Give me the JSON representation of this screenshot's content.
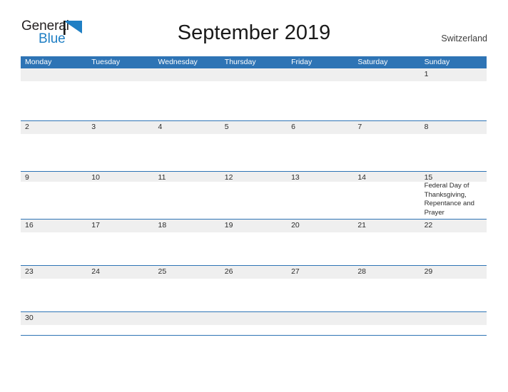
{
  "brand": {
    "line1": "General",
    "line2": "Blue",
    "flag_icon": "blue-triangle-flag-icon",
    "color_dark": "#231f20",
    "color_blue": "#1f7fc4"
  },
  "header": {
    "title": "September 2019",
    "locale": "Switzerland"
  },
  "theme": {
    "header_blue": "#2e74b5",
    "date_band_gray": "#efefef",
    "text_dark": "#2b2b2b",
    "page_background": "#ffffff"
  },
  "calendar": {
    "month": "September",
    "year": "2019",
    "first_day_of_week": "Monday",
    "weekday_headers": [
      "Monday",
      "Tuesday",
      "Wednesday",
      "Thursday",
      "Friday",
      "Saturday",
      "Sunday"
    ],
    "weeks": [
      {
        "days": [
          {
            "num": "",
            "event": ""
          },
          {
            "num": "",
            "event": ""
          },
          {
            "num": "",
            "event": ""
          },
          {
            "num": "",
            "event": ""
          },
          {
            "num": "",
            "event": ""
          },
          {
            "num": "",
            "event": ""
          },
          {
            "num": "1",
            "event": ""
          }
        ]
      },
      {
        "days": [
          {
            "num": "2",
            "event": ""
          },
          {
            "num": "3",
            "event": ""
          },
          {
            "num": "4",
            "event": ""
          },
          {
            "num": "5",
            "event": ""
          },
          {
            "num": "6",
            "event": ""
          },
          {
            "num": "7",
            "event": ""
          },
          {
            "num": "8",
            "event": ""
          }
        ]
      },
      {
        "days": [
          {
            "num": "9",
            "event": ""
          },
          {
            "num": "10",
            "event": ""
          },
          {
            "num": "11",
            "event": ""
          },
          {
            "num": "12",
            "event": ""
          },
          {
            "num": "13",
            "event": ""
          },
          {
            "num": "14",
            "event": ""
          },
          {
            "num": "15",
            "event": "Federal Day of Thanksgiving, Repentance and Prayer"
          }
        ]
      },
      {
        "days": [
          {
            "num": "16",
            "event": ""
          },
          {
            "num": "17",
            "event": ""
          },
          {
            "num": "18",
            "event": ""
          },
          {
            "num": "19",
            "event": ""
          },
          {
            "num": "20",
            "event": ""
          },
          {
            "num": "21",
            "event": ""
          },
          {
            "num": "22",
            "event": ""
          }
        ]
      },
      {
        "days": [
          {
            "num": "23",
            "event": ""
          },
          {
            "num": "24",
            "event": ""
          },
          {
            "num": "25",
            "event": ""
          },
          {
            "num": "26",
            "event": ""
          },
          {
            "num": "27",
            "event": ""
          },
          {
            "num": "28",
            "event": ""
          },
          {
            "num": "29",
            "event": ""
          }
        ]
      },
      {
        "days": [
          {
            "num": "30",
            "event": ""
          },
          {
            "num": "",
            "event": ""
          },
          {
            "num": "",
            "event": ""
          },
          {
            "num": "",
            "event": ""
          },
          {
            "num": "",
            "event": ""
          },
          {
            "num": "",
            "event": ""
          },
          {
            "num": "",
            "event": ""
          }
        ]
      }
    ]
  }
}
